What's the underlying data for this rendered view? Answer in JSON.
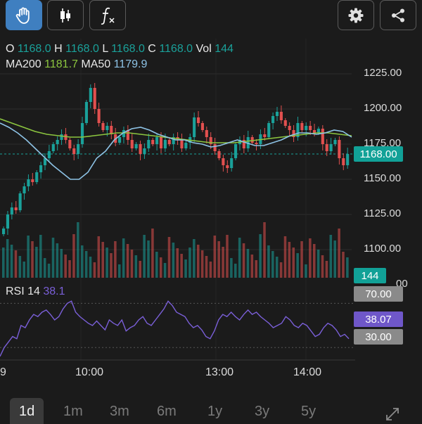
{
  "toolbar": {
    "buttons": [
      {
        "name": "hand-icon",
        "active": true
      },
      {
        "name": "candlestick-icon",
        "active": false
      },
      {
        "name": "function-icon",
        "active": false
      }
    ],
    "right": [
      "gear-icon",
      "share-icon"
    ]
  },
  "ohlc": {
    "o_label": "O",
    "o_value": "1168.0",
    "h_label": "H",
    "h_value": "1168.0",
    "l_label": "L",
    "l_value": "1168.0",
    "c_label": "C",
    "c_value": "1168.0",
    "vol_label": "Vol",
    "vol_value": "144"
  },
  "ma": {
    "ma200_label": "MA200",
    "ma200_value": "1181.7",
    "ma50_label": "MA50",
    "ma50_value": "1179.9"
  },
  "price_axis": [
    "1225.00",
    "1200.00",
    "1175.00",
    "1150.00",
    "1125.00",
    "1100.00"
  ],
  "price_partial": "00",
  "badges": {
    "last_price": "1168.00",
    "volume": "144",
    "rsi_high": "70.00",
    "rsi_value": "38.07",
    "rsi_low": "30.00"
  },
  "rsi": {
    "label": "RSI 14",
    "value": "38.1"
  },
  "time_axis": {
    "left_partial": "9",
    "t1": "10:00",
    "t2": "13:00",
    "t3": "14:00"
  },
  "tabs": [
    "1d",
    "1m",
    "3m",
    "6m",
    "1y",
    "3y",
    "5y"
  ],
  "active_tab": "1d",
  "colors": {
    "up": "#1aa19a",
    "down": "#e2504f",
    "ma200": "#8cc63f",
    "ma50": "#8ec3e6",
    "rsi": "#7a5fd8",
    "accent": "#3f7fc0"
  },
  "chart_data": {
    "type": "candlestick",
    "price_range": [
      1100,
      1230
    ],
    "last_price": 1168,
    "close_series": [
      1115,
      1125,
      1130,
      1128,
      1140,
      1145,
      1150,
      1148,
      1155,
      1160,
      1165,
      1170,
      1175,
      1178,
      1182,
      1178,
      1172,
      1168,
      1175,
      1190,
      1205,
      1215,
      1200,
      1190,
      1185,
      1188,
      1182,
      1176,
      1180,
      1185,
      1178,
      1172,
      1175,
      1168,
      1172,
      1178,
      1175,
      1180,
      1172,
      1178,
      1175,
      1180,
      1178,
      1172,
      1176,
      1180,
      1194,
      1190,
      1185,
      1180,
      1175,
      1170,
      1165,
      1160,
      1158,
      1165,
      1175,
      1178,
      1172,
      1180,
      1176,
      1175,
      1182,
      1180,
      1190,
      1195,
      1198,
      1192,
      1188,
      1185,
      1180,
      1190,
      1185,
      1188,
      1185,
      1183,
      1186,
      1175,
      1170,
      1175,
      1178,
      1165,
      1160,
      1168
    ],
    "ma50": [
      1190,
      1187,
      1183,
      1178,
      1172,
      1166,
      1160,
      1155,
      1150,
      1150,
      1155,
      1165,
      1170,
      1178,
      1183,
      1186,
      1187,
      1185,
      1182,
      1180,
      1178,
      1178,
      1176,
      1175,
      1173,
      1174,
      1176,
      1178,
      1176,
      1174,
      1174,
      1176,
      1178,
      1181,
      1183,
      1183,
      1182,
      1183,
      1185,
      1184,
      1180
    ],
    "ma200": [
      1193,
      1190,
      1187,
      1184,
      1182,
      1181,
      1180,
      1180,
      1181,
      1182,
      1183,
      1183,
      1182,
      1181,
      1180,
      1179,
      1178,
      1177,
      1176,
      1176,
      1176,
      1177,
      1178,
      1179,
      1180,
      1181,
      1182,
      1183,
      1183,
      1182,
      1181
    ],
    "rsi_range": [
      20,
      90
    ],
    "rsi_series": [
      22,
      30,
      35,
      40,
      38,
      50,
      48,
      55,
      60,
      58,
      62,
      64,
      60,
      55,
      58,
      65,
      70,
      72,
      62,
      58,
      55,
      52,
      50,
      54,
      50,
      46,
      55,
      52,
      50,
      55,
      45,
      48,
      50,
      55,
      58,
      52,
      50,
      55,
      60,
      65,
      72,
      68,
      62,
      60,
      58,
      52,
      48,
      50,
      46,
      40,
      38,
      45,
      55,
      60,
      58,
      62,
      58,
      55,
      60,
      64,
      60,
      62,
      58,
      55,
      52,
      48,
      50,
      52,
      58,
      55,
      50,
      48,
      52,
      50,
      45,
      40,
      42,
      48,
      52,
      50,
      46,
      40,
      42,
      38
    ]
  }
}
